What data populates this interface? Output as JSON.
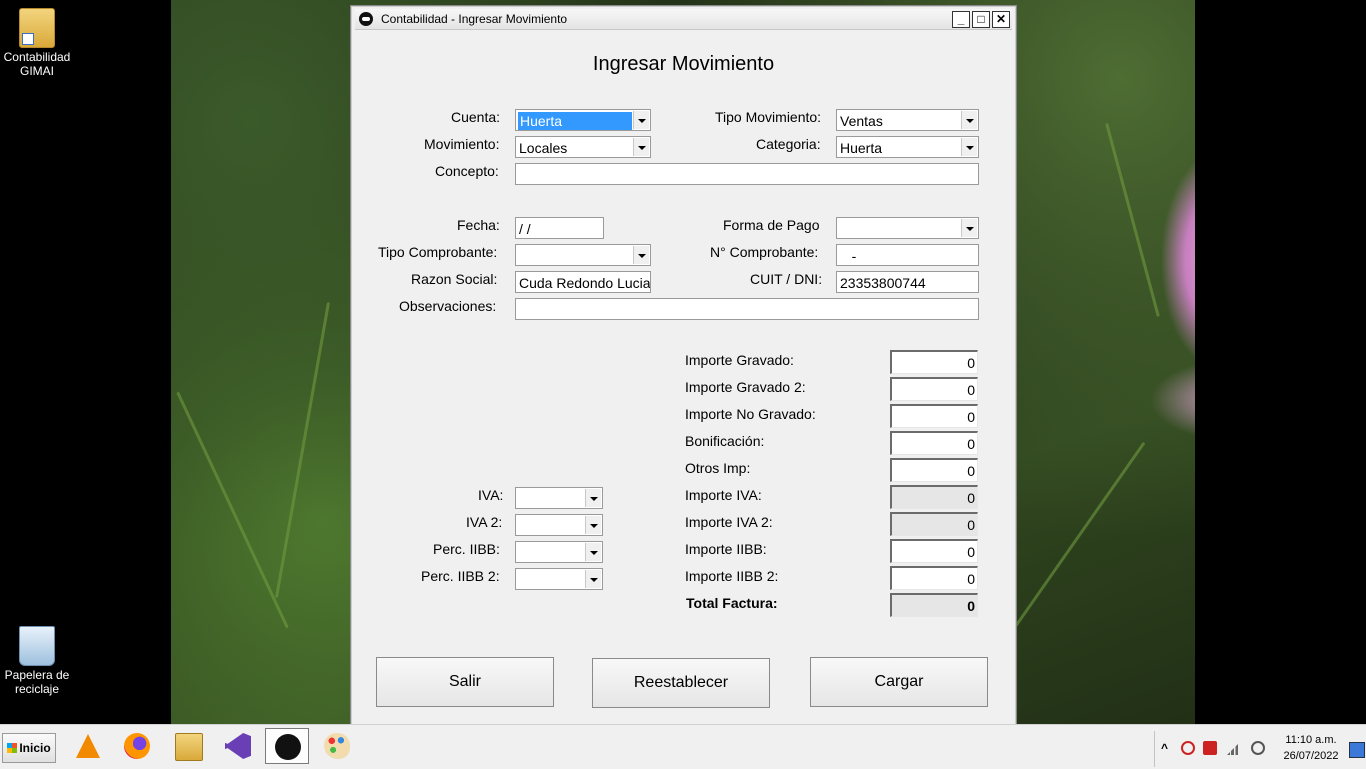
{
  "desktop": {
    "icons": [
      {
        "label": "Contabilidad GIMAI",
        "icon": "folder-shortcut-icon"
      },
      {
        "label": "Papelera de reciclaje",
        "icon": "recycle-bin-icon"
      }
    ]
  },
  "window": {
    "title": "Contabilidad - Ingresar Movimiento",
    "controls": {
      "minimize": "_",
      "maximize": "□",
      "close": "✕"
    },
    "heading": "Ingresar Movimiento"
  },
  "form": {
    "cuenta": {
      "label": "Cuenta:",
      "value": "Huerta"
    },
    "tipo_movimiento": {
      "label": "Tipo Movimiento:",
      "value": "Ventas"
    },
    "movimiento": {
      "label": "Movimiento:",
      "value": "Locales"
    },
    "categoria": {
      "label": "Categoria:",
      "value": "Huerta"
    },
    "concepto": {
      "label": "Concepto:",
      "value": ""
    },
    "fecha": {
      "label": "Fecha:",
      "value": " /  /"
    },
    "forma_pago": {
      "label": "Forma de Pago",
      "value": ""
    },
    "tipo_comprobante": {
      "label": "Tipo Comprobante:",
      "value": ""
    },
    "nro_comprobante": {
      "label": "N° Comprobante:",
      "value": "   -"
    },
    "razon_social": {
      "label": "Razon Social:",
      "value": "Cuda Redondo Lucia"
    },
    "cuit_dni": {
      "label": "CUIT / DNI:",
      "value": "23353800744"
    },
    "observaciones": {
      "label": "Observaciones:",
      "value": ""
    },
    "iva": {
      "label": "IVA:",
      "value": ""
    },
    "iva2": {
      "label": "IVA 2:",
      "value": ""
    },
    "perc_iibb": {
      "label": "Perc. IIBB:",
      "value": ""
    },
    "perc_iibb2": {
      "label": "Perc. IIBB 2:",
      "value": ""
    },
    "importes": [
      {
        "label": "Importe Gravado:",
        "value": "0"
      },
      {
        "label": "Importe Gravado 2:",
        "value": "0"
      },
      {
        "label": "Importe No Gravado:",
        "value": "0"
      },
      {
        "label": "Bonificación:",
        "value": "0"
      },
      {
        "label": "Otros Imp:",
        "value": "0"
      },
      {
        "label": "Importe IVA:",
        "value": "0"
      },
      {
        "label": "Importe IVA 2:",
        "value": "0"
      },
      {
        "label": "Importe IIBB:",
        "value": "0"
      },
      {
        "label": "Importe IIBB 2:",
        "value": "0"
      },
      {
        "label": "Total Factura:",
        "value": "0"
      }
    ]
  },
  "buttons": {
    "salir": "Salir",
    "reestablecer": "Reestablecer",
    "cargar": "Cargar"
  },
  "taskbar": {
    "start_label": "Inicio",
    "apps": [
      "vlc-icon",
      "firefox-icon",
      "file-explorer-icon",
      "visual-studio-icon",
      "contabilidad-app-icon",
      "paint-icon"
    ],
    "clock_time": "11:10 a.m.",
    "clock_date": "26/07/2022"
  },
  "colors": {
    "selection": "#3399ff",
    "window_bg": "#f0f0f0",
    "readonly_bg": "#e6e6e6"
  }
}
